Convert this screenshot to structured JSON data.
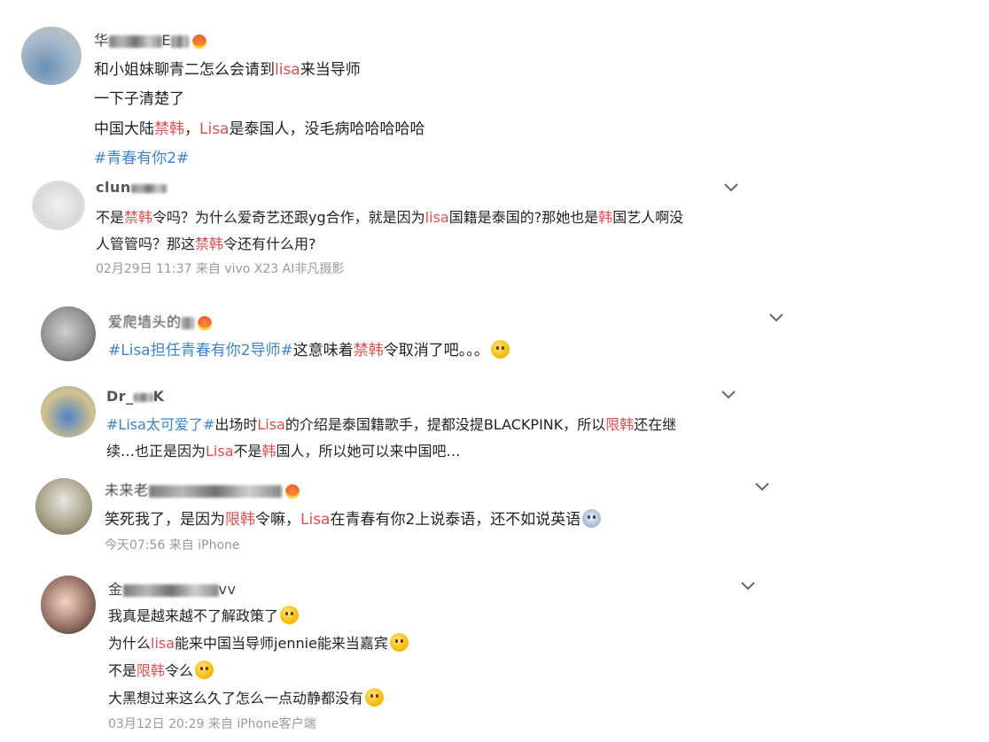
{
  "comments": [
    {
      "username_visible": "华",
      "username_visible_2": "E",
      "lines": [
        [
          {
            "t": "和小姐妹聊青二怎么会请到"
          },
          {
            "t": "lisa",
            "c": "hl"
          },
          {
            "t": "来当导师"
          }
        ],
        [
          {
            "t": "一下子清楚了"
          }
        ],
        [
          {
            "t": "中国大陆"
          },
          {
            "t": "禁韩",
            "c": "hl"
          },
          {
            "t": "，"
          },
          {
            "t": "Lisa",
            "c": "hl"
          },
          {
            "t": "是泰国人，没毛病哈哈哈哈哈"
          }
        ],
        [
          {
            "t": "#青春有你2#",
            "c": "tag"
          }
        ]
      ]
    },
    {
      "username_visible": "clun",
      "lines": [
        [
          {
            "t": "不是"
          },
          {
            "t": "禁韩",
            "c": "hl"
          },
          {
            "t": "令吗？为什么爱奇艺还跟yg合作，就是因为"
          },
          {
            "t": "lisa",
            "c": "hl"
          },
          {
            "t": "国籍是泰国的?那她也是"
          },
          {
            "t": "韩",
            "c": "hl"
          },
          {
            "t": "国艺人啊没"
          }
        ],
        [
          {
            "t": "人管管吗？那这"
          },
          {
            "t": "禁韩",
            "c": "hl"
          },
          {
            "t": "令还有什么用?"
          }
        ]
      ],
      "meta": "02月29日 11:37  来自 vivo X23 AI非凡摄影"
    },
    {
      "username_visible": "爱爬墙头的",
      "lines": [
        [
          {
            "t": "#Lisa担任青春有你2导师#",
            "c": "tag"
          },
          {
            "t": "这意味着"
          },
          {
            "t": "禁韩",
            "c": "hl"
          },
          {
            "t": "令取消了吧。。。"
          }
        ]
      ]
    },
    {
      "username_visible": "Dr_",
      "username_visible_2": "K",
      "lines": [
        [
          {
            "t": "#Lisa太可爱了#",
            "c": "tag"
          },
          {
            "t": "出场时"
          },
          {
            "t": "Lisa",
            "c": "hl"
          },
          {
            "t": "的介绍是泰国籍歌手，提都没提BLACKPINK，所以"
          },
          {
            "t": "限韩",
            "c": "hl"
          },
          {
            "t": "还在继"
          }
        ],
        [
          {
            "t": "续…也正是因为"
          },
          {
            "t": "Lisa",
            "c": "hl"
          },
          {
            "t": "不是"
          },
          {
            "t": "韩",
            "c": "hl"
          },
          {
            "t": "国人，所以她可以来中国吧…"
          }
        ]
      ]
    },
    {
      "username_visible": "未来老",
      "lines": [
        [
          {
            "t": "笑死我了，是因为"
          },
          {
            "t": "限韩",
            "c": "hl"
          },
          {
            "t": "令嘛，"
          },
          {
            "t": "Lisa",
            "c": "hl"
          },
          {
            "t": "在青春有你2上说泰语，还不如说英语"
          }
        ]
      ],
      "meta": "今天07:56  来自 iPhone"
    },
    {
      "username_visible": "金",
      "username_visible_2": "vv",
      "lines": [
        [
          {
            "t": "我真是越来越不了解政策了"
          }
        ],
        [
          {
            "t": "为什么"
          },
          {
            "t": "lisa",
            "c": "hl"
          },
          {
            "t": "能来中国当导师jennie能来当嘉宾"
          }
        ],
        [
          {
            "t": "不是"
          },
          {
            "t": "限韩",
            "c": "hl"
          },
          {
            "t": "令么"
          }
        ],
        [
          {
            "t": "大黑想过来这么久了怎么一点动静都没有"
          }
        ]
      ],
      "meta": "03月12日 20:29  来自 iPhone客户端"
    }
  ]
}
